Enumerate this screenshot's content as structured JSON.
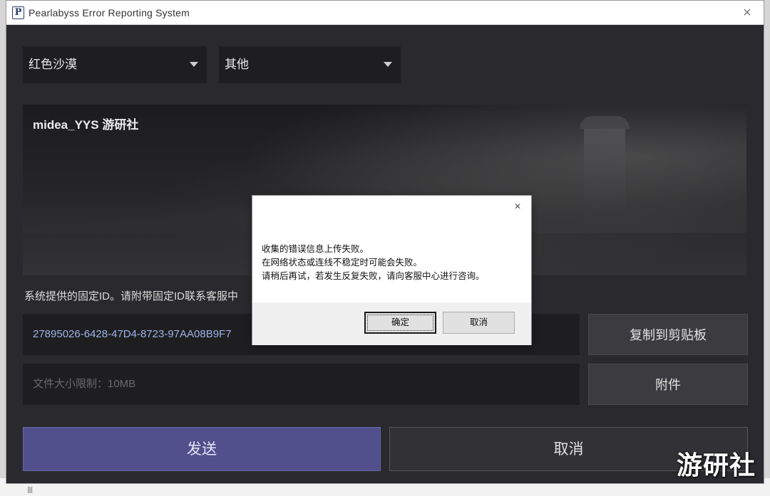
{
  "window": {
    "title": "Pearlabyss Error Reporting System",
    "logo_letter": "P",
    "close_glyph": "×"
  },
  "form": {
    "region_selected": "红色沙漠",
    "category_selected": "其他",
    "message_text": "midea_YYS 游研社",
    "fixed_id_label": "系统提供的固定ID。请附带固定ID联系客服中",
    "fixed_id_value": "27895026-6428-47D4-8723-97AA08B9F7",
    "file_limit_placeholder": "文件大小限制：10MB",
    "copy_button": "复制到剪贴板",
    "attach_button": "附件",
    "send_button": "发送",
    "cancel_button": "取消"
  },
  "modal": {
    "close_glyph": "×",
    "lines": [
      "收集的错误信息上传失败。",
      "在网络状态或连线不稳定时可能会失败。",
      "请稍后再试，若发生反复失败，请向客服中心进行咨询。"
    ],
    "ok_button": "确定",
    "cancel_button": "取消"
  },
  "watermark": "游研社",
  "background_ghost_text": "Ⅲ"
}
